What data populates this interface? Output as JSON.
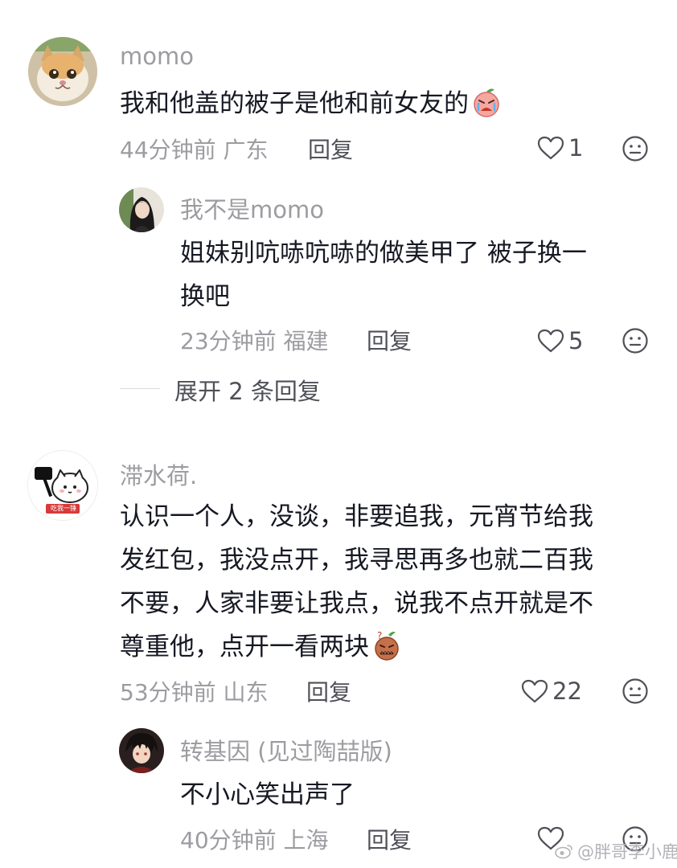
{
  "comments": [
    {
      "username": "momo",
      "text": "我和他盖的被子是他和前女友的",
      "emoji": "crying-peach-emoji",
      "time_location": "44分钟前 广东",
      "reply_label": "回复",
      "likes": "1",
      "replies": [
        {
          "username": "我不是momo",
          "text_line1": "姐妹别吭哧吭哧的做美甲了 被子换一",
          "text_line2": "换吧",
          "time_location": "23分钟前 福建",
          "reply_label": "回复",
          "likes": "5"
        }
      ],
      "expand_label": "展开 2 条回复"
    },
    {
      "username": "滞水荷.",
      "avatar_caption": "吃我一锤",
      "text_line1": "认识一个人，没谈，非要追我，元宵节给我",
      "text_line2": "发红包，我没点开，我寻思再多也就二百我",
      "text_line3": "不要，人家非要让我点，说我不点开就是不",
      "text_line4": "尊重他，点开一看两块",
      "emoji": "confused-peach-emoji",
      "time_location": "53分钟前 山东",
      "reply_label": "回复",
      "likes": "22",
      "replies": [
        {
          "username": "转基因 (见过陶喆版)",
          "text": "不小心笑出声了",
          "time_location": "40分钟前 上海",
          "reply_label": "回复"
        }
      ]
    }
  ],
  "watermark": "@胖哥李小鹿",
  "colors": {
    "text": "#161823",
    "meta": "#9c9ca1",
    "action": "#4f5057",
    "background": "#ffffff"
  }
}
